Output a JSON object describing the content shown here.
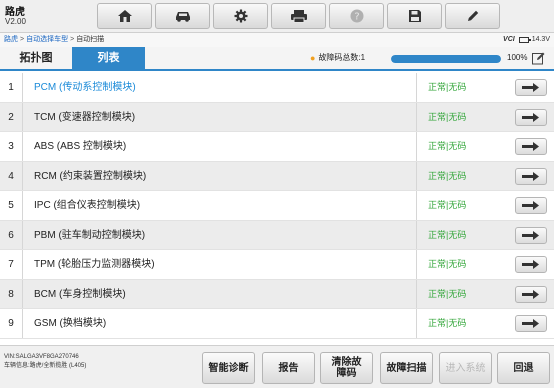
{
  "header": {
    "title": "路虎",
    "version": "V2.00",
    "toolbar": [
      {
        "name": "home-button",
        "icon": "home-icon"
      },
      {
        "name": "vehicle-button",
        "icon": "car-icon"
      },
      {
        "name": "settings-button",
        "icon": "gear-icon"
      },
      {
        "name": "print-button",
        "icon": "printer-icon"
      },
      {
        "name": "help-button",
        "icon": "help-icon"
      },
      {
        "name": "save-button",
        "icon": "save-icon"
      },
      {
        "name": "edit-button",
        "icon": "pencil-icon"
      }
    ]
  },
  "breadcrumb": {
    "items": [
      "路虎",
      "自动选择车型",
      "自动扫描"
    ],
    "vci": "VCI",
    "voltage": "14.3V"
  },
  "tabs": {
    "topology": "拓扑图",
    "list": "列表"
  },
  "scan": {
    "dtc_label": "故障码总数:1",
    "progress_percent": 100,
    "progress_text": "100%"
  },
  "modules": [
    {
      "num": "1",
      "name": "PCM (传动系控制模块)",
      "status": "正常|无码"
    },
    {
      "num": "2",
      "name": "TCM (变速器控制模块)",
      "status": "正常|无码"
    },
    {
      "num": "3",
      "name": "ABS (ABS 控制模块)",
      "status": "正常|无码"
    },
    {
      "num": "4",
      "name": "RCM (约束装置控制模块)",
      "status": "正常|无码"
    },
    {
      "num": "5",
      "name": "IPC (组合仪表控制模块)",
      "status": "正常|无码"
    },
    {
      "num": "6",
      "name": "PBM (驻车制动控制模块)",
      "status": "正常|无码"
    },
    {
      "num": "7",
      "name": "TPM (轮胎压力监测器模块)",
      "status": "正常|无码"
    },
    {
      "num": "8",
      "name": "BCM (车身控制模块)",
      "status": "正常|无码"
    },
    {
      "num": "9",
      "name": "GSM (换档模块)",
      "status": "正常|无码"
    }
  ],
  "footer": {
    "vin": "VIN:SALGA3VF8GA270746",
    "vehicle_info": "车辆信息:路虎/全新揽胜 (L405)",
    "buttons": {
      "smart_diag": "智能诊断",
      "report": "报告",
      "clear_codes": "清除故障码",
      "fault_scan": "故障扫描",
      "enter_system": "进入系统",
      "back": "回退"
    }
  },
  "colors": {
    "accent": "#2f86c8",
    "status_ok": "#33a63a",
    "active_row": "#1a8ad8",
    "dtc_icon": "#f0a020"
  }
}
